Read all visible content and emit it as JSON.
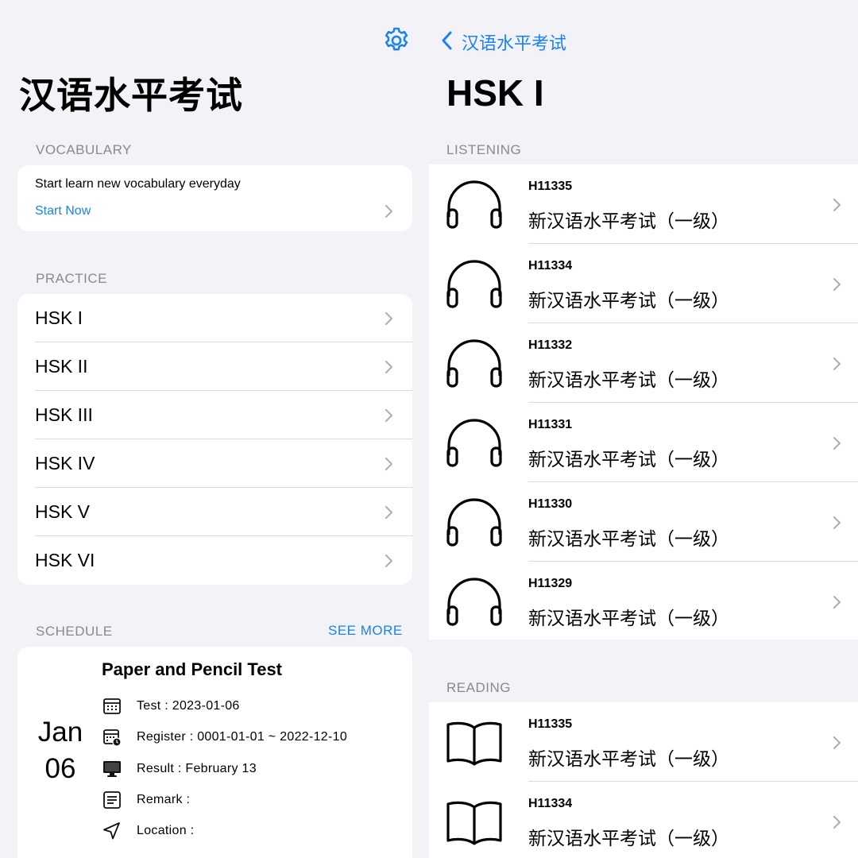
{
  "left": {
    "title": "汉语水平考试",
    "vocabulary": {
      "header": "VOCABULARY",
      "text": "Start learn new vocabulary everyday",
      "link": "Start Now"
    },
    "practice": {
      "header": "PRACTICE",
      "items": [
        "HSK I",
        "HSK II",
        "HSK III",
        "HSK IV",
        "HSK V",
        "HSK VI"
      ]
    },
    "schedule": {
      "header": "SCHEDULE",
      "see_more": "SEE MORE",
      "title": "Paper and Pencil Test",
      "month": "Jan",
      "day": "06",
      "rows": [
        {
          "icon": "calendar-icon",
          "text": "Test  : 2023-01-06"
        },
        {
          "icon": "calendar-clock-icon",
          "text": "Register  : 0001-01-01 ~ 2022-12-10"
        },
        {
          "icon": "monitor-icon",
          "text": "Result  : February 13"
        },
        {
          "icon": "note-icon",
          "text": "Remark  :"
        },
        {
          "icon": "location-arrow-icon",
          "text": "Location  :"
        }
      ]
    }
  },
  "right": {
    "back_label": "汉语水平考试",
    "title": "HSK I",
    "listening": {
      "header": "LISTENING",
      "items": [
        {
          "code": "H11335",
          "name": "新汉语水平考试（一级）"
        },
        {
          "code": "H11334",
          "name": "新汉语水平考试（一级）"
        },
        {
          "code": "H11332",
          "name": "新汉语水平考试（一级）"
        },
        {
          "code": "H11331",
          "name": "新汉语水平考试（一级）"
        },
        {
          "code": "H11330",
          "name": "新汉语水平考试（一级）"
        },
        {
          "code": "H11329",
          "name": "新汉语水平考试（一级）"
        }
      ]
    },
    "reading": {
      "header": "READING",
      "items": [
        {
          "code": "H11335",
          "name": "新汉语水平考试（一级）"
        },
        {
          "code": "H11334",
          "name": "新汉语水平考试（一级）"
        }
      ]
    }
  },
  "colors": {
    "accent": "#1a82f3",
    "background": "#f2f2f7",
    "secondary_text": "#8a8a8e"
  }
}
